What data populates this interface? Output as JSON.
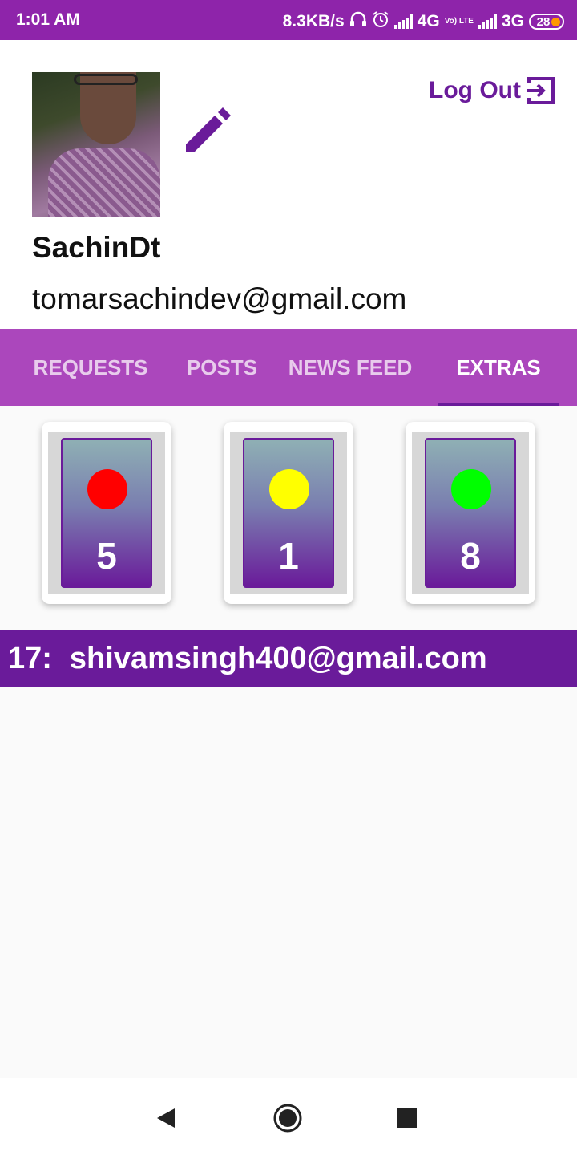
{
  "status_bar": {
    "time": "1:01 AM",
    "speed": "8.3KB/s",
    "network1": "4G",
    "network1_sub": "Vo) LTE",
    "network2": "3G",
    "battery": "28",
    "icons": [
      "headset-icon",
      "alarm-icon",
      "signal-icon",
      "signal-icon",
      "battery-icon"
    ]
  },
  "profile": {
    "username": "SachinDt",
    "email": "tomarsachindev@gmail.com",
    "logout_label": "Log Out"
  },
  "tabs": [
    {
      "label": "REQUESTS",
      "active": false
    },
    {
      "label": "POSTS",
      "active": false
    },
    {
      "label": "NEWS FEED",
      "active": false
    },
    {
      "label": "EXTRAS",
      "active": true
    }
  ],
  "cards": [
    {
      "count": "5",
      "color": "#ff0000"
    },
    {
      "count": "1",
      "color": "#ffff00"
    },
    {
      "count": "8",
      "color": "#00ff00"
    }
  ],
  "info_bar": {
    "count": "17:",
    "email": "shivamsingh400@gmail.com"
  },
  "colors": {
    "status_bar": "#8e24aa",
    "tab_bar": "#ab47bc",
    "accent": "#6a1b9a"
  }
}
